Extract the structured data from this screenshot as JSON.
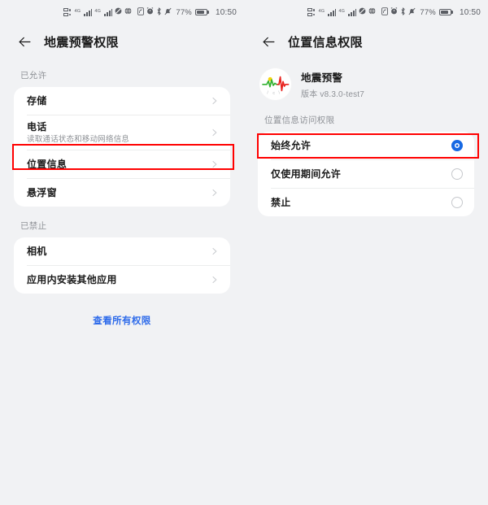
{
  "meta": {
    "accent_blue": "#1668e3",
    "link_blue": "#2e6bea",
    "highlight_red": "#ff0000",
    "page_background": "#f1f2f4",
    "card_background": "#ffffff"
  },
  "statusbar": {
    "battery_percent": "77%",
    "clock": "10:50",
    "icons": [
      "dual-sim-icon",
      "signal-bars-icon",
      "signal-bars-icon",
      "no-sound-icon",
      "globe-icon",
      "nfc-icon",
      "alarm-icon",
      "bluetooth-icon",
      "mute-bell-icon",
      "battery-icon"
    ]
  },
  "left_screen": {
    "appbar": {
      "back_label": "back-arrow",
      "title": "地震预警权限"
    },
    "sections": [
      {
        "label": "已允许",
        "items": [
          {
            "title": "存储",
            "subtitle": ""
          },
          {
            "title": "电话",
            "subtitle": "读取通话状态和移动网络信息"
          },
          {
            "title": "位置信息",
            "subtitle": "",
            "highlighted": true
          },
          {
            "title": "悬浮窗",
            "subtitle": ""
          }
        ]
      },
      {
        "label": "已禁止",
        "items": [
          {
            "title": "相机",
            "subtitle": ""
          },
          {
            "title": "应用内安装其他应用",
            "subtitle": ""
          }
        ]
      }
    ],
    "footer_link": "查看所有权限"
  },
  "right_screen": {
    "appbar": {
      "back_label": "back-arrow",
      "title": "位置信息权限"
    },
    "app": {
      "name": "地震预警",
      "version": "版本 v8.3.0-test7",
      "icon": "earthquake-warning-app-icon"
    },
    "permission_group_label": "位置信息访问权限",
    "options": [
      {
        "label": "始终允许",
        "selected": true,
        "highlighted": true
      },
      {
        "label": "仅使用期间允许",
        "selected": false
      },
      {
        "label": "禁止",
        "selected": false
      }
    ]
  }
}
